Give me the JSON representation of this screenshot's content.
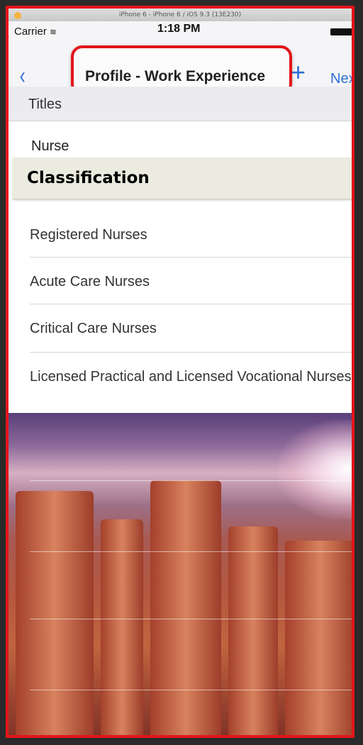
{
  "simulator_title": "iPhone 6 - iPhone 6 / iOS 9.3 (13E230)",
  "status": {
    "carrier": "Carrier",
    "time": "1:18 PM"
  },
  "nav": {
    "back_symbol": "‹",
    "title": "Profile - Work Experience",
    "add_symbol": "+",
    "next_label": "Next"
  },
  "titles_section": {
    "header": "Titles",
    "value": "Nurse"
  },
  "classification_label": "Classification",
  "classification_items": [
    "Registered Nurses",
    "Acute Care Nurses",
    "Critical Care Nurses",
    "Licensed Practical and Licensed Vocational Nurses"
  ],
  "colors": {
    "accent": "#2f6fd6",
    "highlight": "#e3151a",
    "classification_bg": "#ecebe0"
  }
}
